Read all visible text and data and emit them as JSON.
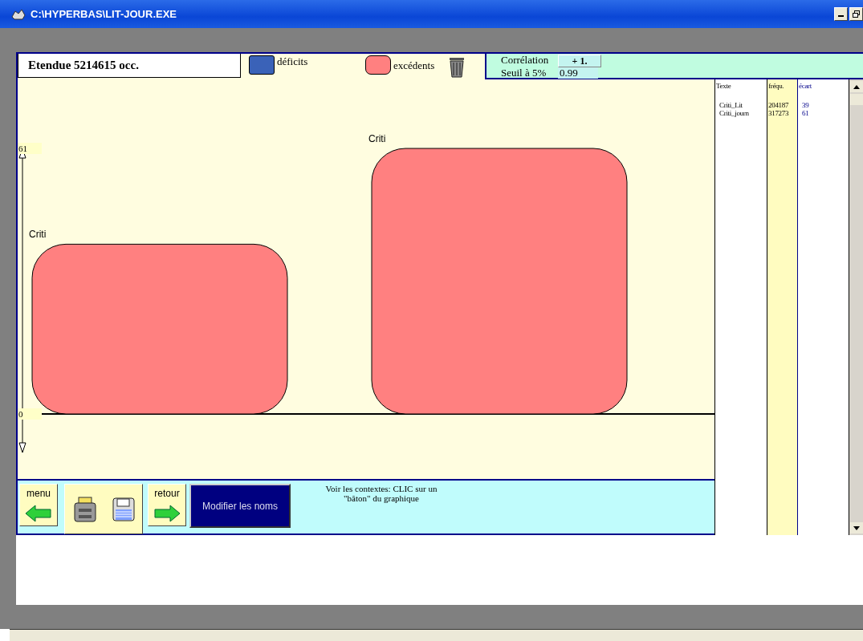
{
  "window": {
    "title": "C:\\HYPERBAS\\LIT-JOUR.EXE"
  },
  "header": {
    "extent": "Etendue  5214615 occ.",
    "legend": [
      {
        "label": "déficits",
        "color": "#3a62b8"
      },
      {
        "label": "excédents",
        "color": "#ff8080"
      }
    ],
    "correlation_label": "Corrélation",
    "correlation_value": "+ 1.",
    "threshold_label": "Seuil à 5%",
    "threshold_value": "0.99"
  },
  "chart": {
    "chart_data": {
      "type": "bar",
      "categories": [
        "Criti",
        "Criti"
      ],
      "yticks": [
        0,
        61
      ],
      "ylim": [
        0,
        61
      ],
      "series": [
        {
          "color": "#ff8080",
          "values": [
            39,
            61
          ]
        }
      ]
    }
  },
  "table": {
    "columns": [
      "Texte",
      "fréqu.",
      "écart"
    ],
    "rows": [
      {
        "cells": [
          "Criti_Lit",
          "204187",
          "39"
        ]
      },
      {
        "cells": [
          "Criti_journ",
          "317273",
          "61"
        ]
      }
    ]
  },
  "toolbar": {
    "menu": "menu",
    "back": "retour",
    "rename": "Modifier les noms",
    "hint": "Voir les contextes: CLIC sur un \"bâton\" du graphique"
  }
}
